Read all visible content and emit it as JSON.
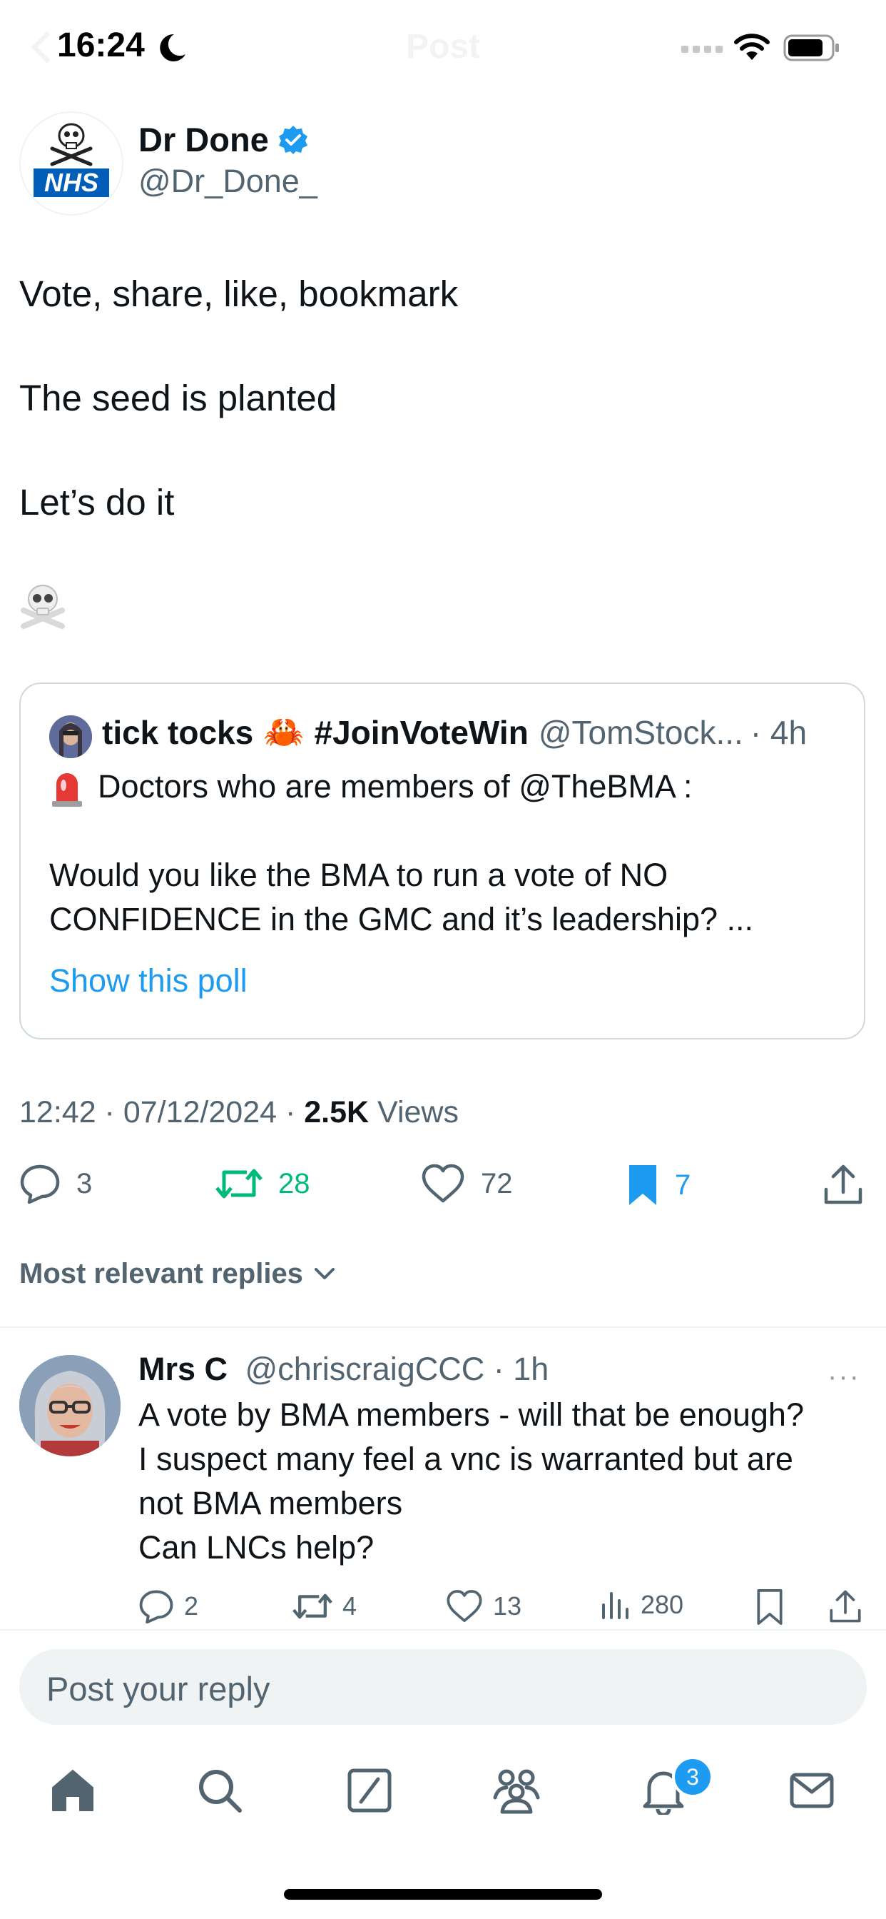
{
  "status_bar": {
    "time": "16:24",
    "ghost_title": "Post",
    "icons": [
      "moon-icon",
      "signal-icon",
      "wifi-icon",
      "battery-icon"
    ]
  },
  "post": {
    "author_name": "Dr Done",
    "author_handle": "@Dr_Done_",
    "avatar_logo_text": "NHS",
    "lines": [
      "Vote, share, like, bookmark",
      "The seed is planted",
      "Let’s do it",
      "☠️"
    ],
    "quote": {
      "name": "tick tocks",
      "crab_emoji": "🦀",
      "name_tag": "#JoinVoteWin",
      "handle": "@TomStock...",
      "time": "· 4h",
      "siren_emoji": "🚨",
      "line1": "Doctors who are members of @TheBMA :",
      "line2": "Would you like the BMA to run a vote of NO",
      "line3": "CONFIDENCE in the GMC and it’s leadership? ...",
      "poll_link": "Show this poll"
    },
    "meta": {
      "time_date": "12:42 · 07/12/2024 · ",
      "views_count": "2.5K",
      "views_label": " Views"
    },
    "actions": {
      "replies": "3",
      "reposts": "28",
      "likes": "72",
      "bookmarks": "7"
    },
    "colors": {
      "repost": "#00ba7c",
      "bookmark": "#1d9bf0",
      "link": "#1d9bf0",
      "secondary": "#536471"
    }
  },
  "sort_label": "Most relevant replies",
  "reply": {
    "name": "Mrs C",
    "handle": "@chriscraigCCC",
    "time": " · 1h",
    "more": "···",
    "lines": [
      "A vote by BMA members - will that be enough?",
      "I suspect many feel a vnc is warranted but are",
      "not BMA members",
      "Can LNCs help?"
    ],
    "actions": {
      "replies": "2",
      "reposts": "4",
      "likes": "13",
      "views": "280"
    }
  },
  "reply_input": {
    "placeholder": "Post your reply"
  },
  "bottom_nav": {
    "items": [
      "home-icon",
      "search-icon",
      "compose-icon",
      "communities-icon",
      "notifications-icon",
      "messages-icon"
    ],
    "notification_badge": "3"
  }
}
